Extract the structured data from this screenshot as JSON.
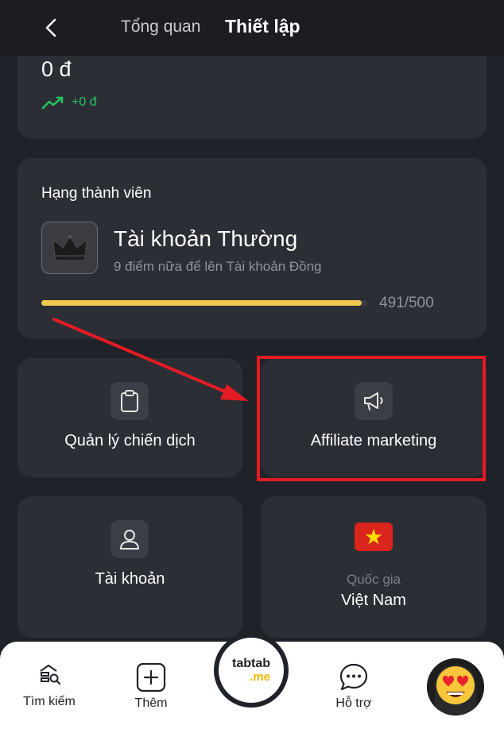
{
  "header": {
    "tab_overview": "Tổng quan",
    "tab_settings": "Thiết lập"
  },
  "balance": {
    "value": "0 đ",
    "change": "+0 đ"
  },
  "membership": {
    "title": "Hạng thành viên",
    "tier": "Tài khoản Thường",
    "next_tier_hint": "9 điểm nữa để lên Tài khoản Đồng",
    "points": 491,
    "points_max": 500,
    "progress_text": "491/500",
    "progress_color": "#f0c94e"
  },
  "tiles": {
    "campaign": {
      "label": "Quản lý chiến dịch",
      "icon": "clipboard-icon"
    },
    "affiliate": {
      "label": "Affiliate marketing",
      "icon": "megaphone-icon"
    },
    "account": {
      "label": "Tài khoản",
      "icon": "user-icon"
    },
    "country": {
      "caption": "Quốc gia",
      "value": "Việt Nam",
      "icon": "vietnam-flag-icon"
    }
  },
  "bottom_nav": {
    "search": "Tìm kiếm",
    "more": "Thêm",
    "support": "Hỗ trợ"
  },
  "logo": {
    "top": "tabtab",
    "bottom": ".me"
  },
  "colors": {
    "background": "#1f2228",
    "card": "#2b2e35",
    "accent_green": "#21c45d",
    "highlight_red": "#e51b23"
  }
}
